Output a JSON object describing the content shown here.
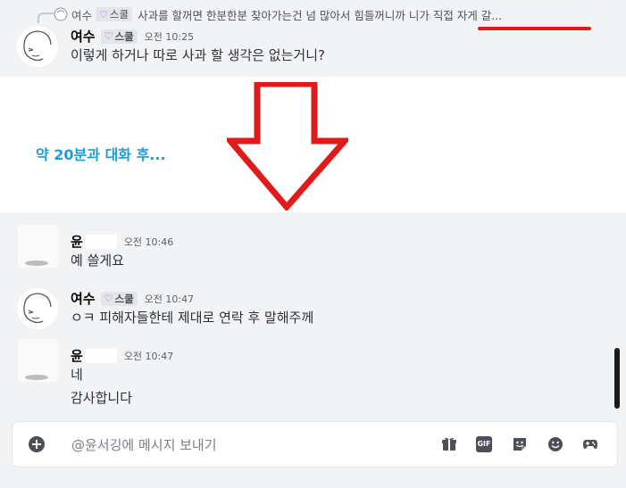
{
  "reply_ref": {
    "author": "여수",
    "tag_label": "스쿨",
    "text": "사과를 할꺼면 한분한분 찾아가는건 넘 많아서 힘들꺼니까 니가 직접 자게 갈..."
  },
  "messages": [
    {
      "author": "여수",
      "tag_label": "스쿨",
      "timestamp": "오전 10:25",
      "lines": [
        "이렇게 하거나 따로 사과 할 생각은 없는거니?"
      ]
    },
    {
      "author": "윤",
      "timestamp": "오전 10:46",
      "lines": [
        "예 쓸게요"
      ]
    },
    {
      "author": "여수",
      "tag_label": "스쿨",
      "timestamp": "오전 10:47",
      "lines": [
        "ㅇㅋ 피해자들한테 제대로 연락 후 말해주께"
      ]
    },
    {
      "author": "윤",
      "timestamp": "오전 10:47",
      "lines": [
        "네",
        "감사합니다"
      ]
    }
  ],
  "annotation": "약 20분과 대화 후...",
  "input": {
    "placeholder": "@윤서깅에 메시지 보내기",
    "value": ""
  },
  "toolbar": {
    "gif_label": "GIF",
    "icons": [
      "gift-icon",
      "gif-icon",
      "sticker-icon",
      "emoji-icon",
      "game-icon"
    ]
  },
  "colors": {
    "annotation": "#1f9bd6",
    "arrow": "#e01b1b",
    "tag_heart": "#8a5cd6",
    "panel_bg": "#f2f3f5"
  }
}
